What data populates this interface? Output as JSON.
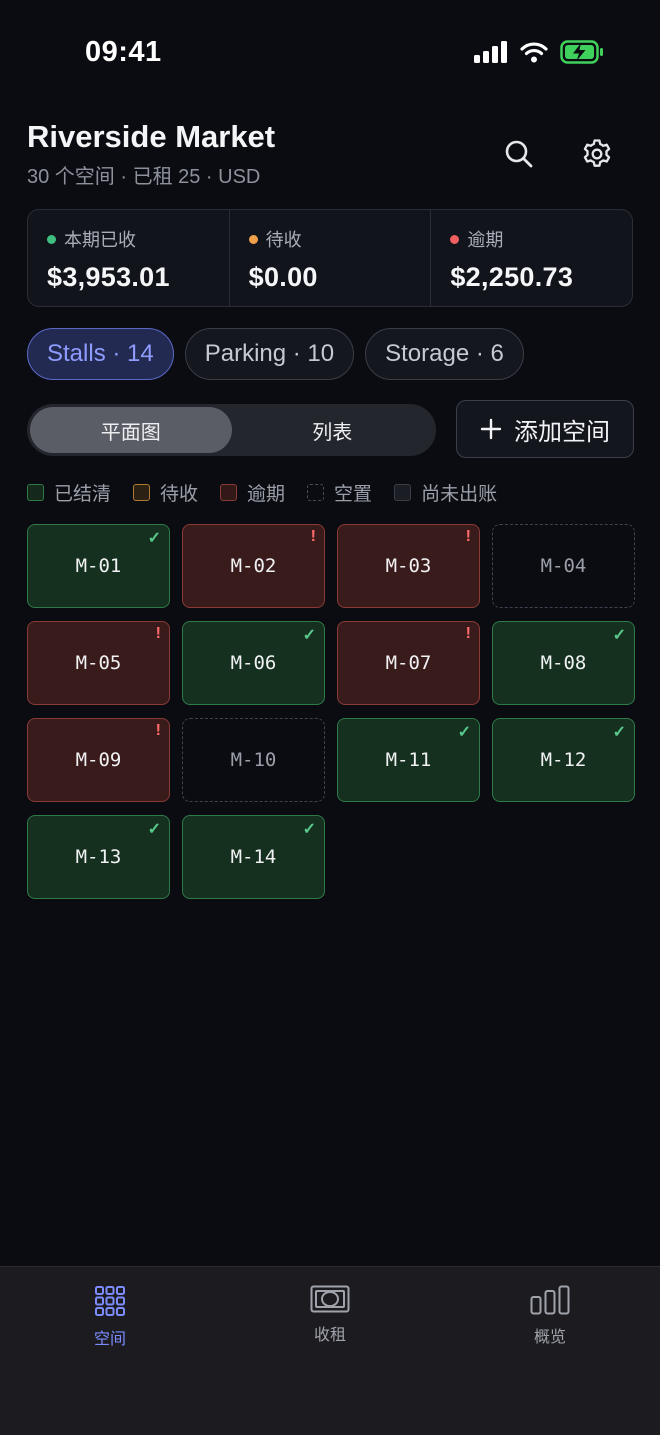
{
  "status_bar": {
    "time": "09:41"
  },
  "header": {
    "title": "Riverside Market",
    "subtitle": "30 个空间 · 已租 25 · USD"
  },
  "summary": [
    {
      "label": "本期已收",
      "value": "$3,953.01",
      "dot_color": "#3fbf7f"
    },
    {
      "label": "待收",
      "value": "$0.00",
      "dot_color": "#f0a04b"
    },
    {
      "label": "逾期",
      "value": "$2,250.73",
      "dot_color": "#f05f5f"
    }
  ],
  "categories": [
    {
      "label": "Stalls · 14",
      "active": true
    },
    {
      "label": "Parking · 10",
      "active": false
    },
    {
      "label": "Storage · 6",
      "active": false
    }
  ],
  "view_toggle": {
    "floor_plan": "平面图",
    "list": "列表",
    "active": "floor_plan"
  },
  "add_button": {
    "label": "添加空间",
    "icon": "plus-icon"
  },
  "legend": [
    {
      "label": "已结清",
      "status": "paid"
    },
    {
      "label": "待收",
      "status": "pending"
    },
    {
      "label": "逾期",
      "status": "overdue"
    },
    {
      "label": "空置",
      "status": "vacant"
    },
    {
      "label": "尚未出账",
      "status": "unbilled"
    }
  ],
  "stalls": [
    {
      "id": "M-01",
      "status": "paid",
      "mark": "✓"
    },
    {
      "id": "M-02",
      "status": "overdue",
      "mark": "!"
    },
    {
      "id": "M-03",
      "status": "overdue",
      "mark": "!"
    },
    {
      "id": "M-04",
      "status": "vacant",
      "mark": ""
    },
    {
      "id": "M-05",
      "status": "overdue",
      "mark": "!"
    },
    {
      "id": "M-06",
      "status": "paid",
      "mark": "✓"
    },
    {
      "id": "M-07",
      "status": "overdue",
      "mark": "!"
    },
    {
      "id": "M-08",
      "status": "paid",
      "mark": "✓"
    },
    {
      "id": "M-09",
      "status": "overdue",
      "mark": "!"
    },
    {
      "id": "M-10",
      "status": "vacant",
      "mark": ""
    },
    {
      "id": "M-11",
      "status": "paid",
      "mark": "✓"
    },
    {
      "id": "M-12",
      "status": "paid",
      "mark": "✓"
    },
    {
      "id": "M-13",
      "status": "paid",
      "mark": "✓"
    },
    {
      "id": "M-14",
      "status": "paid",
      "mark": "✓"
    }
  ],
  "tab_bar": [
    {
      "label": "空间",
      "icon": "grid-icon",
      "active": true
    },
    {
      "label": "收租",
      "icon": "cash-icon",
      "active": false
    },
    {
      "label": "概览",
      "icon": "bar-chart-icon",
      "active": false
    }
  ],
  "colors": {
    "accent": "#7c8bff",
    "paid": "#2e7a48",
    "overdue": "#8a3a36",
    "pending": "#b07a2e",
    "background": "#0b0c12"
  }
}
